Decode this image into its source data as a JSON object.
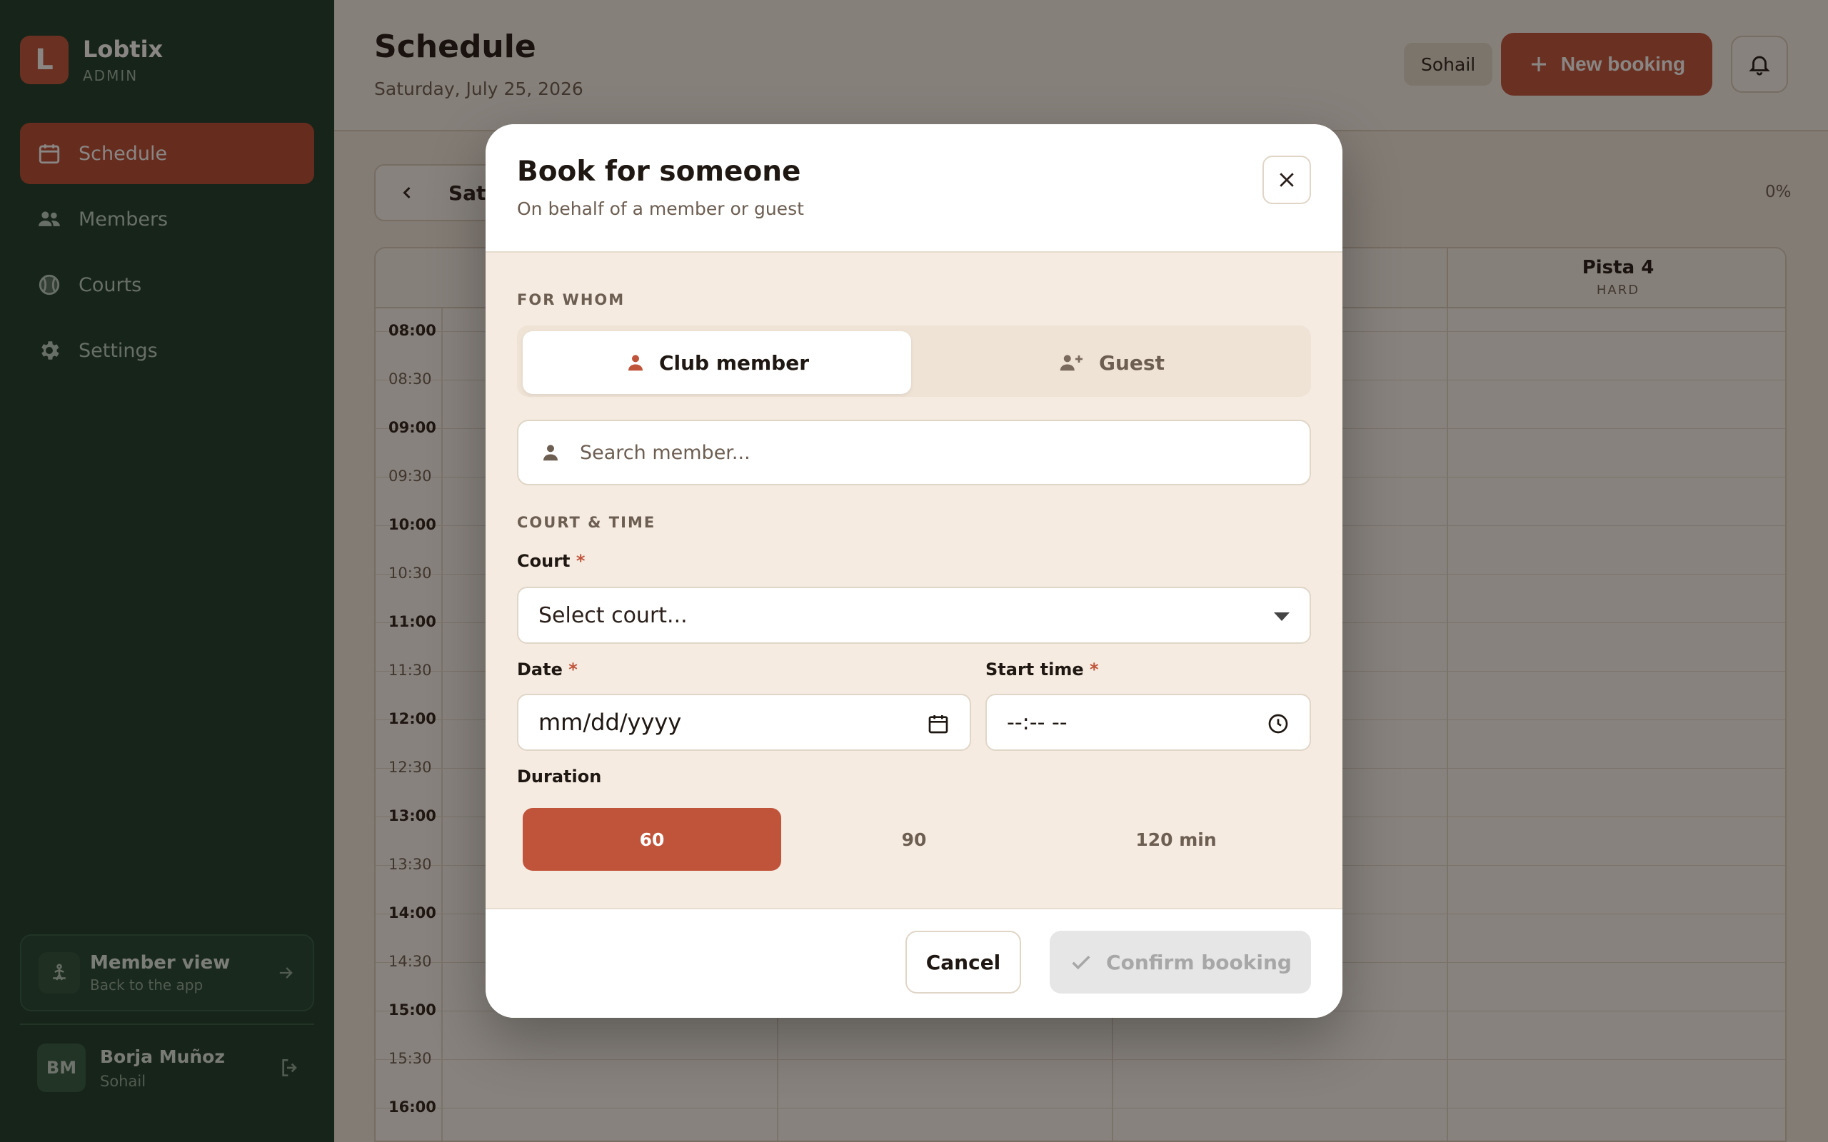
{
  "brand": {
    "logo_letter": "L",
    "name": "Lobtix",
    "role": "ADMIN"
  },
  "nav": {
    "items": [
      {
        "label": "Schedule",
        "icon": "calendar-icon",
        "active": true
      },
      {
        "label": "Members",
        "icon": "users-icon",
        "active": false
      },
      {
        "label": "Courts",
        "icon": "ball-icon",
        "active": false
      },
      {
        "label": "Settings",
        "icon": "gear-icon",
        "active": false
      }
    ]
  },
  "member_view": {
    "title": "Member view",
    "subtitle": "Back to the app"
  },
  "user": {
    "initials": "BM",
    "name": "Borja Muñoz",
    "club": "Sohail"
  },
  "header": {
    "title": "Schedule",
    "date": "Saturday, July 25, 2026",
    "club": "Sohail",
    "new_booking_label": "New booking"
  },
  "schedule": {
    "day_label": "Sat",
    "occupancy": "0%",
    "courts": [
      {
        "name": "Pista 4",
        "surface": "HARD"
      }
    ],
    "times": [
      "08:00",
      "08:30",
      "09:00",
      "09:30",
      "10:00",
      "10:30",
      "11:00",
      "11:30",
      "12:00",
      "12:30",
      "13:00",
      "13:30",
      "14:00",
      "14:30",
      "15:00",
      "15:30",
      "16:00"
    ]
  },
  "modal": {
    "title": "Book for someone",
    "subtitle": "On behalf of a member or guest",
    "for_whom_label": "FOR WHOM",
    "options": {
      "member": "Club member",
      "guest": "Guest"
    },
    "search_placeholder": "Search member...",
    "court_time_label": "COURT & TIME",
    "court_label": "Court",
    "court_placeholder": "Select court...",
    "date_label": "Date",
    "date_placeholder": "mm/dd/yyyy",
    "start_time_label": "Start time",
    "start_time_placeholder": "--:-- --",
    "required_mark": "*",
    "duration_label": "Duration",
    "durations": [
      "60",
      "90",
      "120 min"
    ],
    "selected_duration": "60",
    "cancel_label": "Cancel",
    "confirm_label": "Confirm booking"
  },
  "colors": {
    "sidebar": "#1b3a29",
    "accent": "#c0543b",
    "background": "#f3ebe1"
  }
}
